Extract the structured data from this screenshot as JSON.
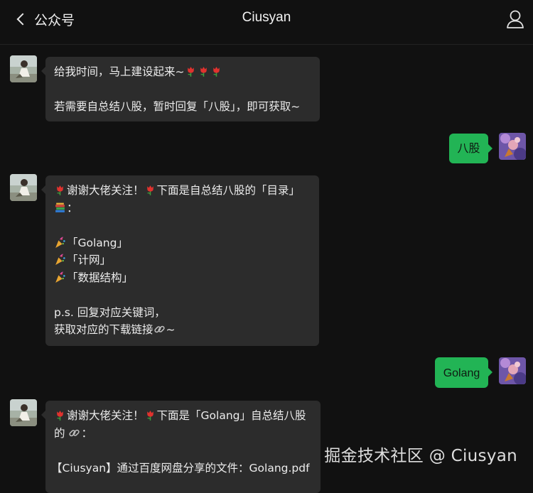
{
  "header": {
    "back_label": "公众号",
    "title": "Ciusyan"
  },
  "messages": {
    "m1": {
      "line1": "给我时间，马上建设起来~",
      "line2": "若需要自总结八股，暂时回复「八股」，即可获取~"
    },
    "m2": {
      "text": "八股"
    },
    "m3": {
      "line1_a": "谢谢大佬关注！",
      "line1_b": "下面是自总结八股的「目录」",
      "line2": "：",
      "item1": "「Golang」",
      "item2": "「计网」",
      "item3": "「数据结构」",
      "ps1": "p.s. 回复对应关键词，",
      "ps2": "获取对应的下载链接",
      "ps2_tail": "~"
    },
    "m4": {
      "text": "Golang"
    },
    "m5": {
      "line1_a": "谢谢大佬关注！",
      "line1_b": "下面是「Golang」自总结八股",
      "line2": "的",
      "line2_tail": "：",
      "line3": "【Ciusyan】通过百度网盘分享的文件：Golang.pdf"
    }
  },
  "watermark": "掘金技术社区 @ Ciusyan",
  "icons": {
    "back": "chevron-left-icon",
    "profile": "person-icon",
    "flower": "tulip-emoji",
    "books": "books-emoji",
    "party": "party-popper-emoji",
    "link": "link-emoji"
  },
  "colors": {
    "background": "#111111",
    "incoming_bubble": "#2c2c2c",
    "outgoing_bubble": "#22b455"
  }
}
